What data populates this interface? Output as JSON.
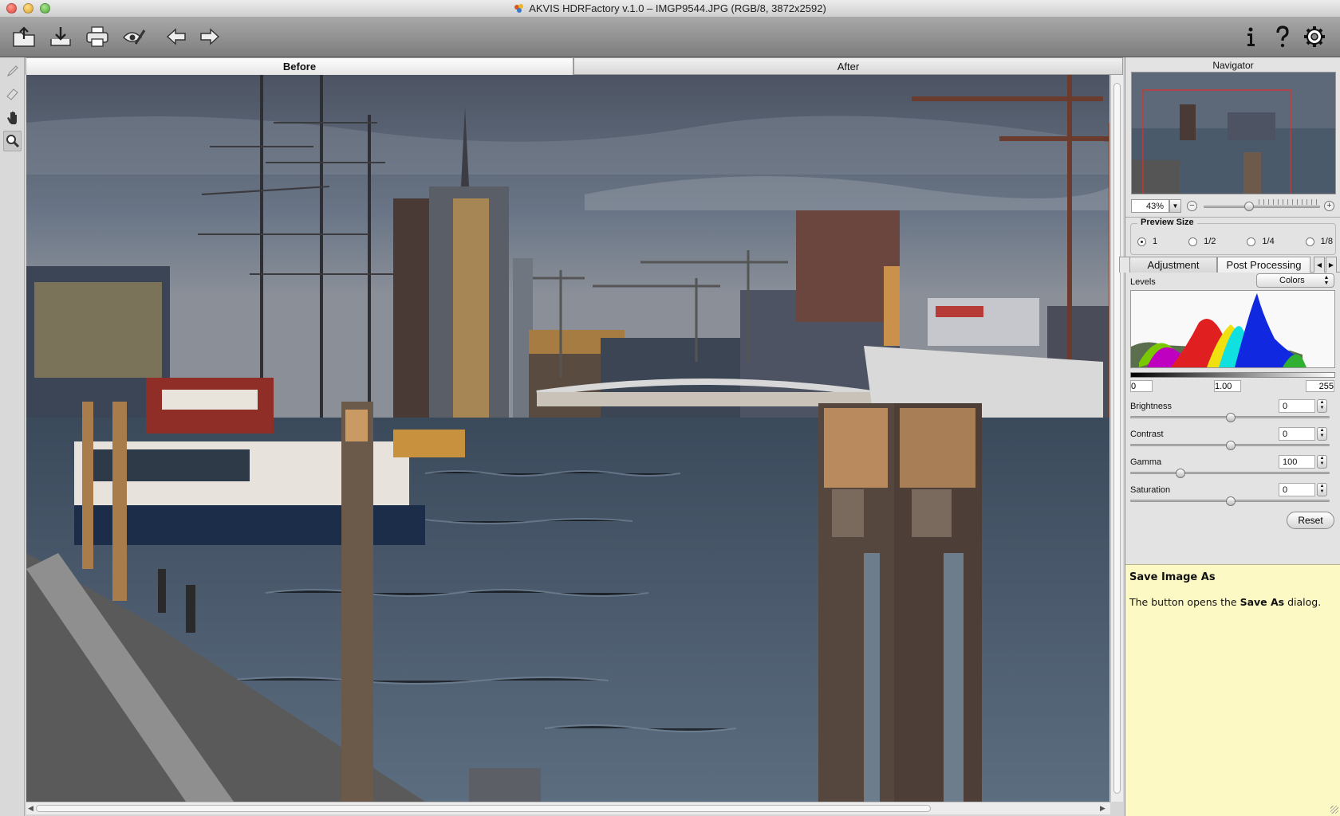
{
  "window": {
    "title": "AKVIS HDRFactory v.1.0 – IMGP9544.JPG (RGB/8, 3872x2592)"
  },
  "toolbar": {
    "buttons": [
      "open-icon",
      "save-icon",
      "print-icon",
      "preferences-eye-icon",
      "back-icon",
      "forward-icon"
    ],
    "right_buttons": [
      "info-icon",
      "help-icon",
      "settings-icon"
    ]
  },
  "tools": [
    "brush-icon",
    "eraser-icon",
    "hand-icon",
    "zoom-icon"
  ],
  "view_tabs": {
    "before": "Before",
    "after": "After"
  },
  "navigator": {
    "title": "Navigator",
    "zoom": "43%"
  },
  "preview_size": {
    "label": "Preview Size",
    "options": [
      "1",
      "1/2",
      "1/4",
      "1/8"
    ],
    "selected": "1"
  },
  "panel_tabs": {
    "adjustment": "Adjustment",
    "post_processing": "Post Processing"
  },
  "levels": {
    "label": "Levels",
    "channel": "Colors",
    "black": "0",
    "gamma": "1.00",
    "white": "255"
  },
  "sliders": {
    "brightness": {
      "label": "Brightness",
      "value": "0"
    },
    "contrast": {
      "label": "Contrast",
      "value": "0"
    },
    "gamma": {
      "label": "Gamma",
      "value": "100"
    },
    "saturation": {
      "label": "Saturation",
      "value": "0"
    }
  },
  "reset_label": "Reset",
  "help": {
    "title": "Save Image As",
    "text_prefix": "The button opens the ",
    "text_bold": "Save As",
    "text_suffix": " dialog."
  },
  "colors": {
    "toolbar": "#8f8f8f",
    "help_bg": "#fdf9c5",
    "water": "#4d5d6e",
    "sky": "#5c6a7b"
  }
}
